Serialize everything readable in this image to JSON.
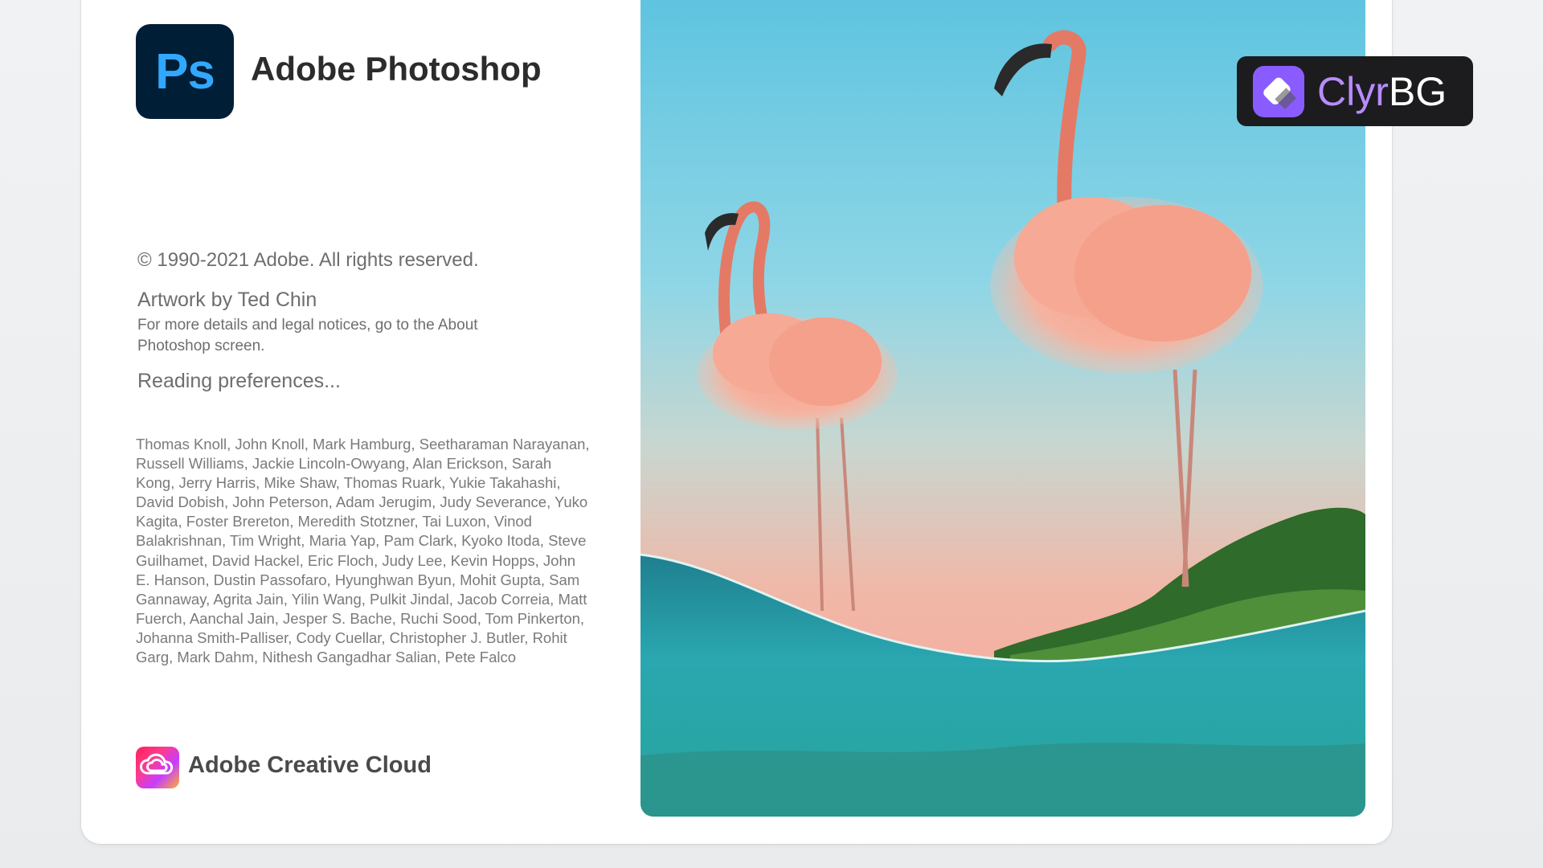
{
  "app": {
    "title": "Adobe Photoshop",
    "logo_text": "Ps"
  },
  "splash": {
    "copyright": "© 1990-2021 Adobe. All rights reserved.",
    "artwork_credit": "Artwork by Ted Chin",
    "legal_notice": "For more details and legal notices, go to the About Photoshop screen.",
    "status": "Reading preferences...",
    "credits": "Thomas Knoll, John Knoll, Mark Hamburg, Seetharaman Narayanan, Russell Williams, Jackie Lincoln-Owyang, Alan Erickson, Sarah Kong, Jerry Harris, Mike Shaw, Thomas Ruark, Yukie Takahashi, David Dobish, John Peterson, Adam Jerugim, Judy Severance, Yuko Kagita, Foster Brereton, Meredith Stotzner, Tai Luxon, Vinod Balakrishnan, Tim Wright, Maria Yap, Pam Clark, Kyoko Itoda, Steve Guilhamet, David Hackel, Eric Floch, Judy Lee, Kevin Hopps, John E. Hanson, Dustin Passofaro, Hyunghwan Byun, Mohit Gupta, Sam Gannaway, Agrita Jain, Yilin Wang, Pulkit Jindal, Jacob Correia, Matt Fuerch, Aanchal Jain, Jesper S. Bache, Ruchi Sood, Tom Pinkerton, Johanna Smith-Palliser, Cody Cuellar, Christopher J. Butler, Rohit Garg, Mark Dahm, Nithesh Gangadhar Salian, Pete Falco"
  },
  "footer": {
    "brand": "Adobe Creative Cloud"
  },
  "watermark": {
    "text_part1": "Clyr",
    "text_part2": "BG"
  },
  "colors": {
    "ps_logo_bg": "#001e36",
    "ps_logo_fg": "#31a8ff",
    "watermark_bg": "#1c1c1e",
    "watermark_accent": "#b88bff"
  },
  "icons": {
    "app_logo": "photoshop-logo-icon",
    "footer_logo": "creative-cloud-icon",
    "watermark_logo": "clyrbg-logo-icon"
  }
}
